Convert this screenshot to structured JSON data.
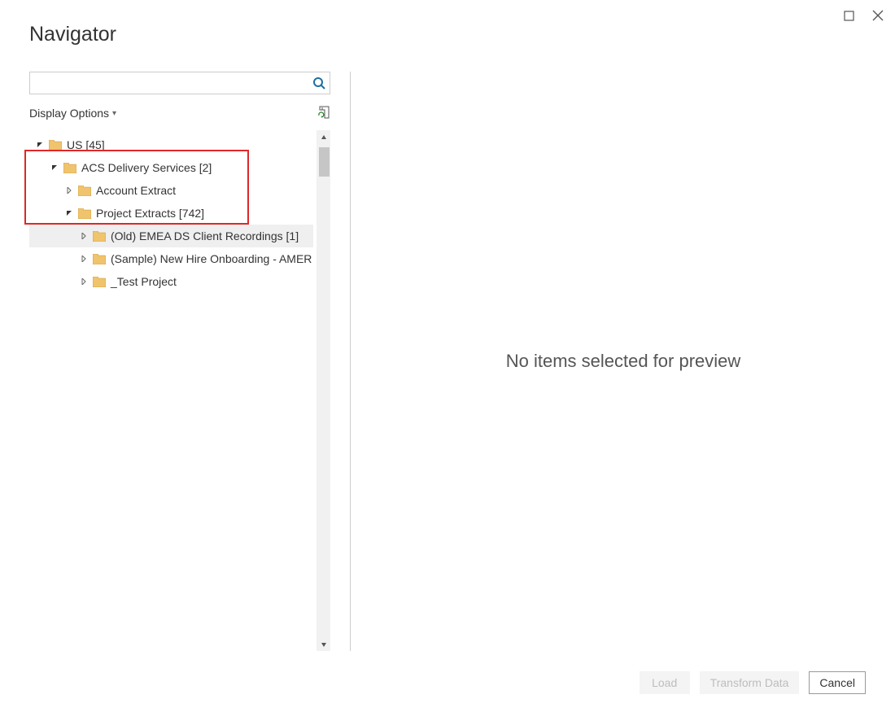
{
  "title": "Navigator",
  "windowControls": {
    "maximize": "maximize",
    "close": "close"
  },
  "search": {
    "value": "",
    "placeholder": ""
  },
  "displayOptions": {
    "label": "Display Options"
  },
  "tree": {
    "items": [
      {
        "label": "US [45]",
        "indent": 0,
        "expanded": true,
        "hasChildren": true,
        "selected": false
      },
      {
        "label": "ACS Delivery Services [2]",
        "indent": 1,
        "expanded": true,
        "hasChildren": true,
        "selected": false
      },
      {
        "label": "Account Extract",
        "indent": 2,
        "expanded": false,
        "hasChildren": true,
        "selected": false
      },
      {
        "label": "Project Extracts [742]",
        "indent": 2,
        "expanded": true,
        "hasChildren": true,
        "selected": false
      },
      {
        "label": "(Old) EMEA DS Client Recordings [1]",
        "indent": 3,
        "expanded": false,
        "hasChildren": true,
        "selected": true
      },
      {
        "label": "(Sample) New Hire Onboarding - AMER",
        "indent": 3,
        "expanded": false,
        "hasChildren": true,
        "selected": false
      },
      {
        "label": "_Test Project",
        "indent": 3,
        "expanded": false,
        "hasChildren": true,
        "selected": false
      }
    ],
    "highlightRange": {
      "startIndex": 1,
      "endIndex": 3
    }
  },
  "preview": {
    "emptyMessage": "No items selected for preview"
  },
  "footer": {
    "load": "Load",
    "transform": "Transform Data",
    "cancel": "Cancel"
  }
}
